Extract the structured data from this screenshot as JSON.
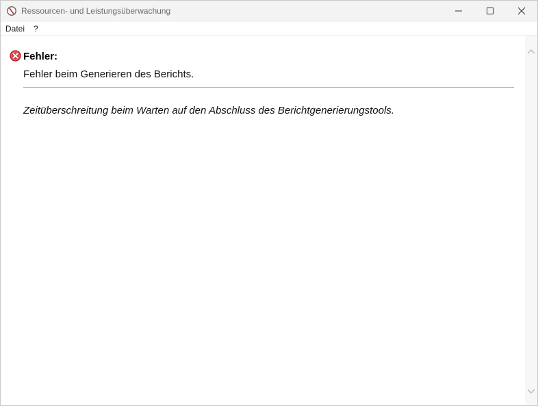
{
  "window": {
    "title": "Ressourcen- und Leistungsüberwachung",
    "icon": "resource-monitor-icon",
    "controls": [
      "minimize-icon",
      "maximize-icon",
      "close-icon"
    ]
  },
  "menu": {
    "items": [
      {
        "label": "Datei"
      },
      {
        "label": "?"
      }
    ]
  },
  "report": {
    "heading": "Fehler:",
    "message": "Fehler beim Generieren des Berichts.",
    "detail": "Zeitüberschreitung beim Warten auf den Abschluss des Berichtgenerierungstools.",
    "icon": "error-icon",
    "error_color": "#d9363e"
  }
}
